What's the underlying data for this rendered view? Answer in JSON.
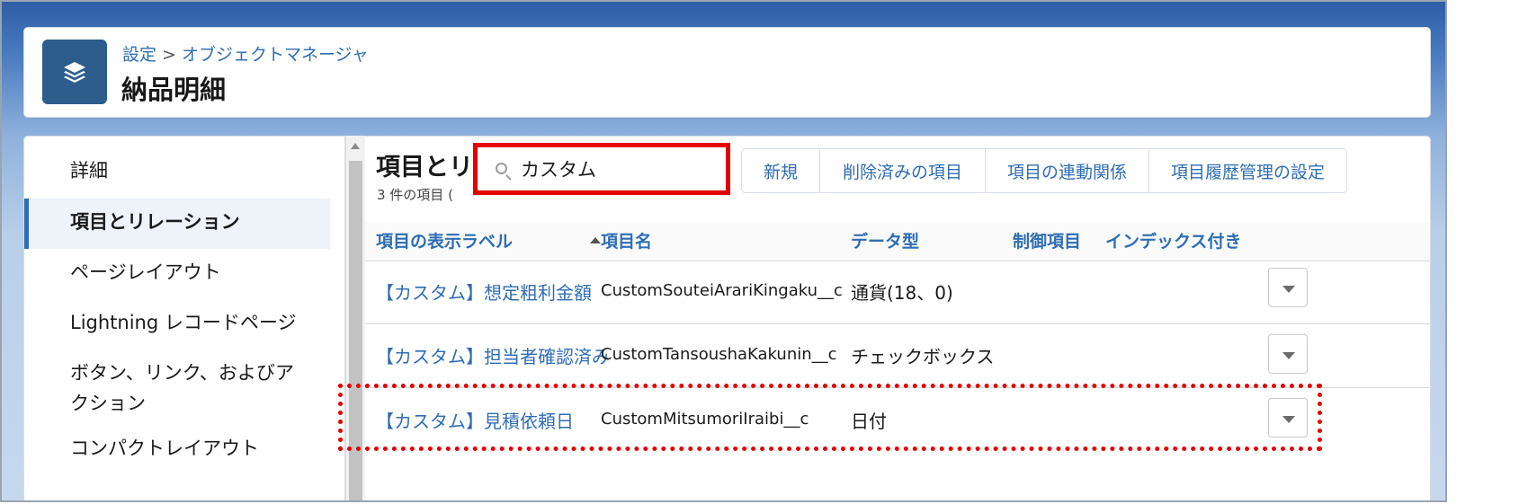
{
  "header": {
    "breadcrumb_setup": "設定",
    "breadcrumb_sep": ">",
    "breadcrumb_object_manager": "オブジェクトマネージャ",
    "title": "納品明細",
    "icon": "layers-icon"
  },
  "sidebar": {
    "items": [
      {
        "label": "詳細"
      },
      {
        "label": "項目とリレーション",
        "active": true
      },
      {
        "label": "ページレイアウト"
      },
      {
        "label": "Lightning レコードページ"
      },
      {
        "label": "ボタン、リンク、およびア\nクション"
      },
      {
        "label": "コンパクトレイアウト"
      }
    ]
  },
  "main": {
    "title_visible": "項目とリ",
    "count_visible": "3 件の項目 (",
    "search": {
      "value": "カスタム",
      "icon": "search-icon"
    },
    "buttons": [
      "新規",
      "削除済みの項目",
      "項目の連動関係",
      "項目履歴管理の設定"
    ],
    "columns": [
      "項目の表示ラベル",
      "項目名",
      "データ型",
      "制御項目",
      "インデックス付き"
    ],
    "rows": [
      {
        "label": "【カスタム】想定粗利金額",
        "api": "CustomSouteiArariKingaku__c",
        "type": "通貨(18、0)"
      },
      {
        "label": "【カスタム】担当者確認済み",
        "api": "CustomTansoushaKakunin__c",
        "type": "チェックボックス"
      },
      {
        "label": "【カスタム】見積依頼日",
        "api": "CustomMitsumoriIraibi__c",
        "type": "日付"
      }
    ]
  },
  "colors": {
    "link": "#2e6db4",
    "highlight": "#e40000",
    "icon_bg": "#2c5d8d"
  }
}
